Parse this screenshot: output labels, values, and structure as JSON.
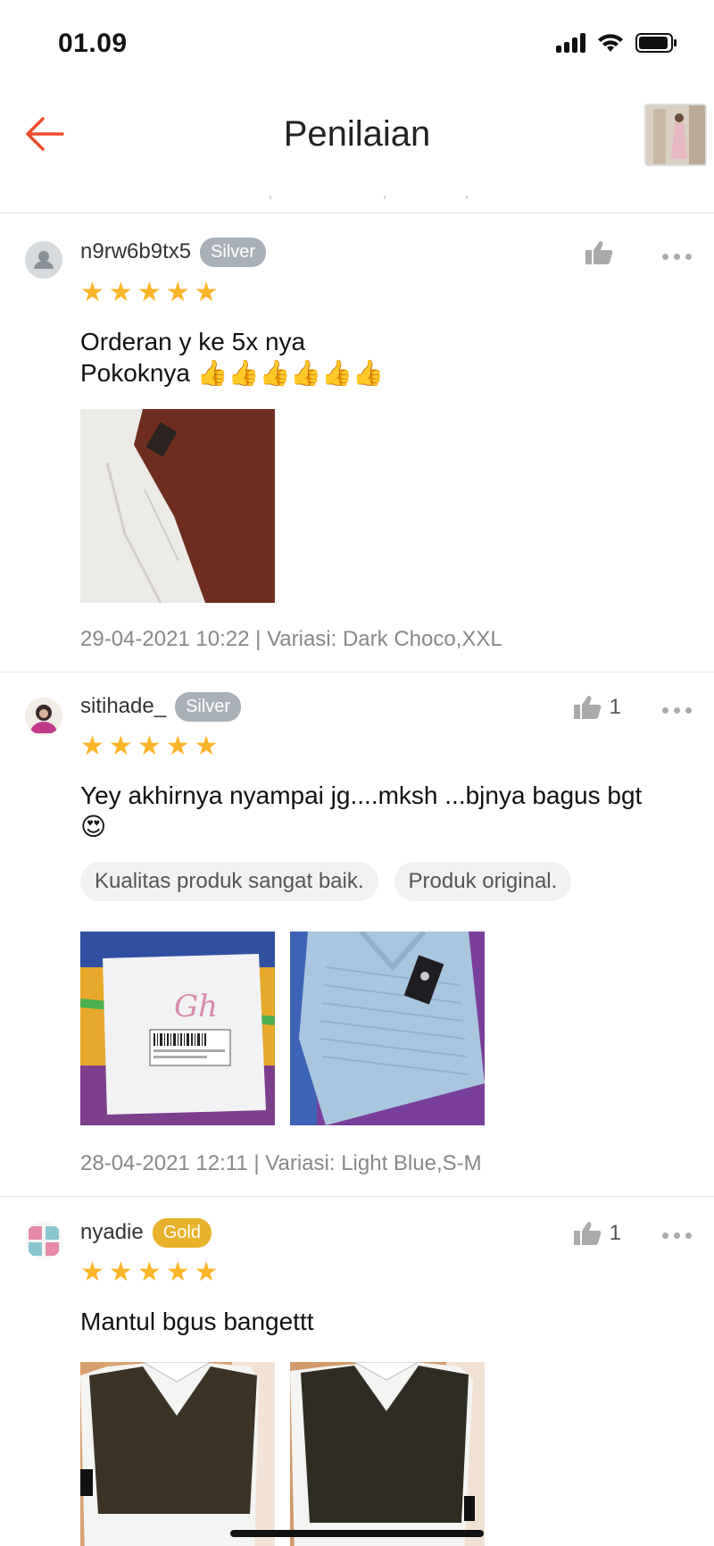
{
  "status_bar": {
    "time": "01.09",
    "icons": [
      "signal-icon",
      "wifi-icon",
      "battery-icon"
    ]
  },
  "nav": {
    "title": "Penilaian",
    "back_icon": "arrow-left-icon",
    "accent": "#ee4d2d"
  },
  "reviews": [
    {
      "username": "n9rw6b9tx5",
      "badge": "Silver",
      "like_count": "",
      "rating": 5,
      "text_lines": [
        "Orderan y ke 5x nya",
        "Pokoknya 👍👍👍👍👍👍"
      ],
      "tags": [],
      "meta": "29-04-2021 10:22 | Variasi: Dark Choco,XXL"
    },
    {
      "username": "sitihade_",
      "badge": "Silver",
      "like_count": "1",
      "rating": 5,
      "text_lines": [
        "Yey  akhirnya nyampai jg....mksh ...bjnya bagus bgt",
        "😍"
      ],
      "tags": [
        "Kualitas produk sangat baik.",
        "Produk original."
      ],
      "meta": "28-04-2021 12:11 | Variasi: Light Blue,S-M"
    },
    {
      "username": "nyadie",
      "badge": "Gold",
      "like_count": "1",
      "rating": 5,
      "text_lines": [
        "Mantul bgus bangettt"
      ],
      "tags": [],
      "meta": ""
    }
  ],
  "colors": {
    "star": "#fdb528",
    "silver_badge": "#a9b0b8",
    "gold_badge": "#e9b22b"
  }
}
